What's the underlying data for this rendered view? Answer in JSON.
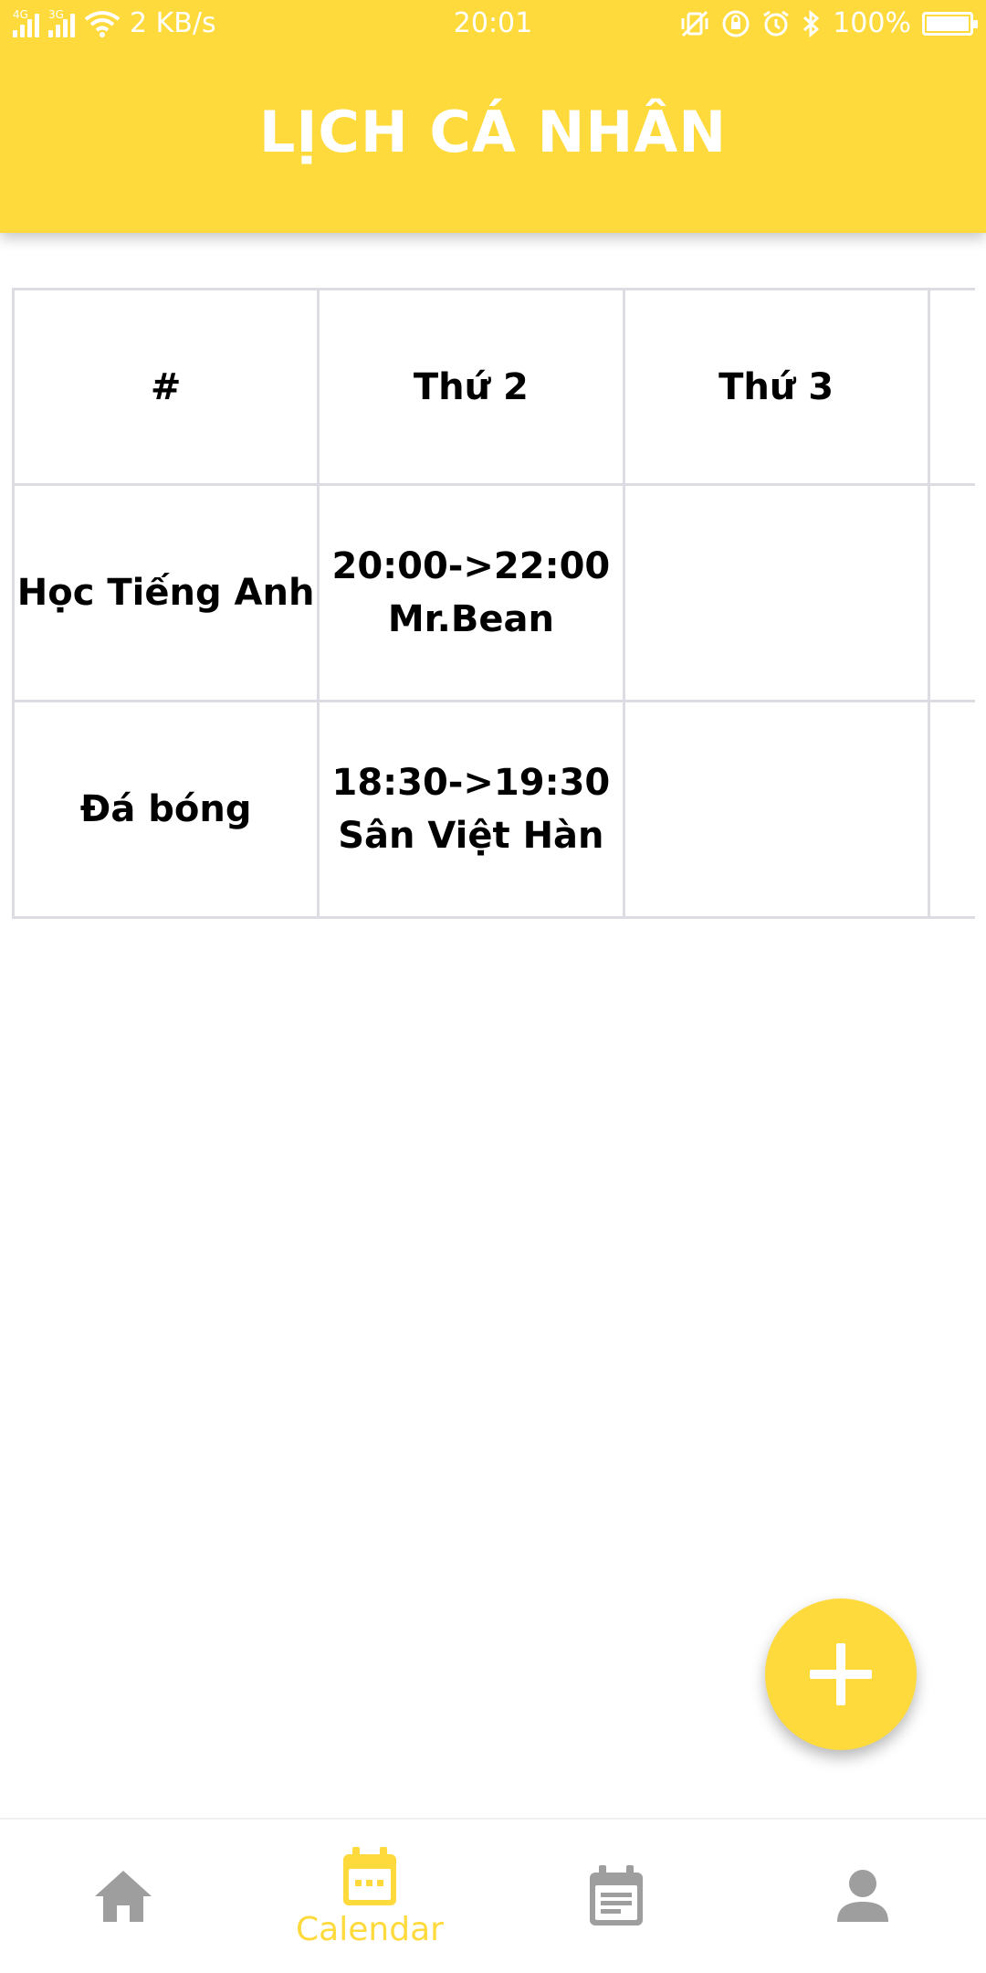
{
  "status_bar": {
    "network_4g": "4G",
    "network_3g": "3G",
    "speed": "2 KB/s",
    "time": "20:01",
    "battery": "100%"
  },
  "app_bar": {
    "title": "LỊCH CÁ NHÂN"
  },
  "schedule": {
    "headers": [
      "#",
      "Thứ 2",
      "Thứ 3",
      ""
    ],
    "rows": [
      {
        "activity": "Học Tiếng Anh",
        "mon_time": "20:00->22:00",
        "mon_place": "Mr.Bean",
        "tue": "",
        "wed": ""
      },
      {
        "activity": "Đá bóng",
        "mon_time": "18:30->19:30",
        "mon_place": "Sân Việt Hàn",
        "tue": "",
        "wed": ""
      }
    ]
  },
  "fab": {
    "icon": "plus-icon"
  },
  "bottom_nav": {
    "items": [
      {
        "icon": "home-icon",
        "label": ""
      },
      {
        "icon": "calendar-icon",
        "label": "Calendar",
        "active": true
      },
      {
        "icon": "notes-icon",
        "label": ""
      },
      {
        "icon": "profile-icon",
        "label": ""
      }
    ]
  },
  "colors": {
    "accent": "#FEDA3C",
    "inactive_icon": "#9E9E9E",
    "grid": "#DCDCE2"
  }
}
